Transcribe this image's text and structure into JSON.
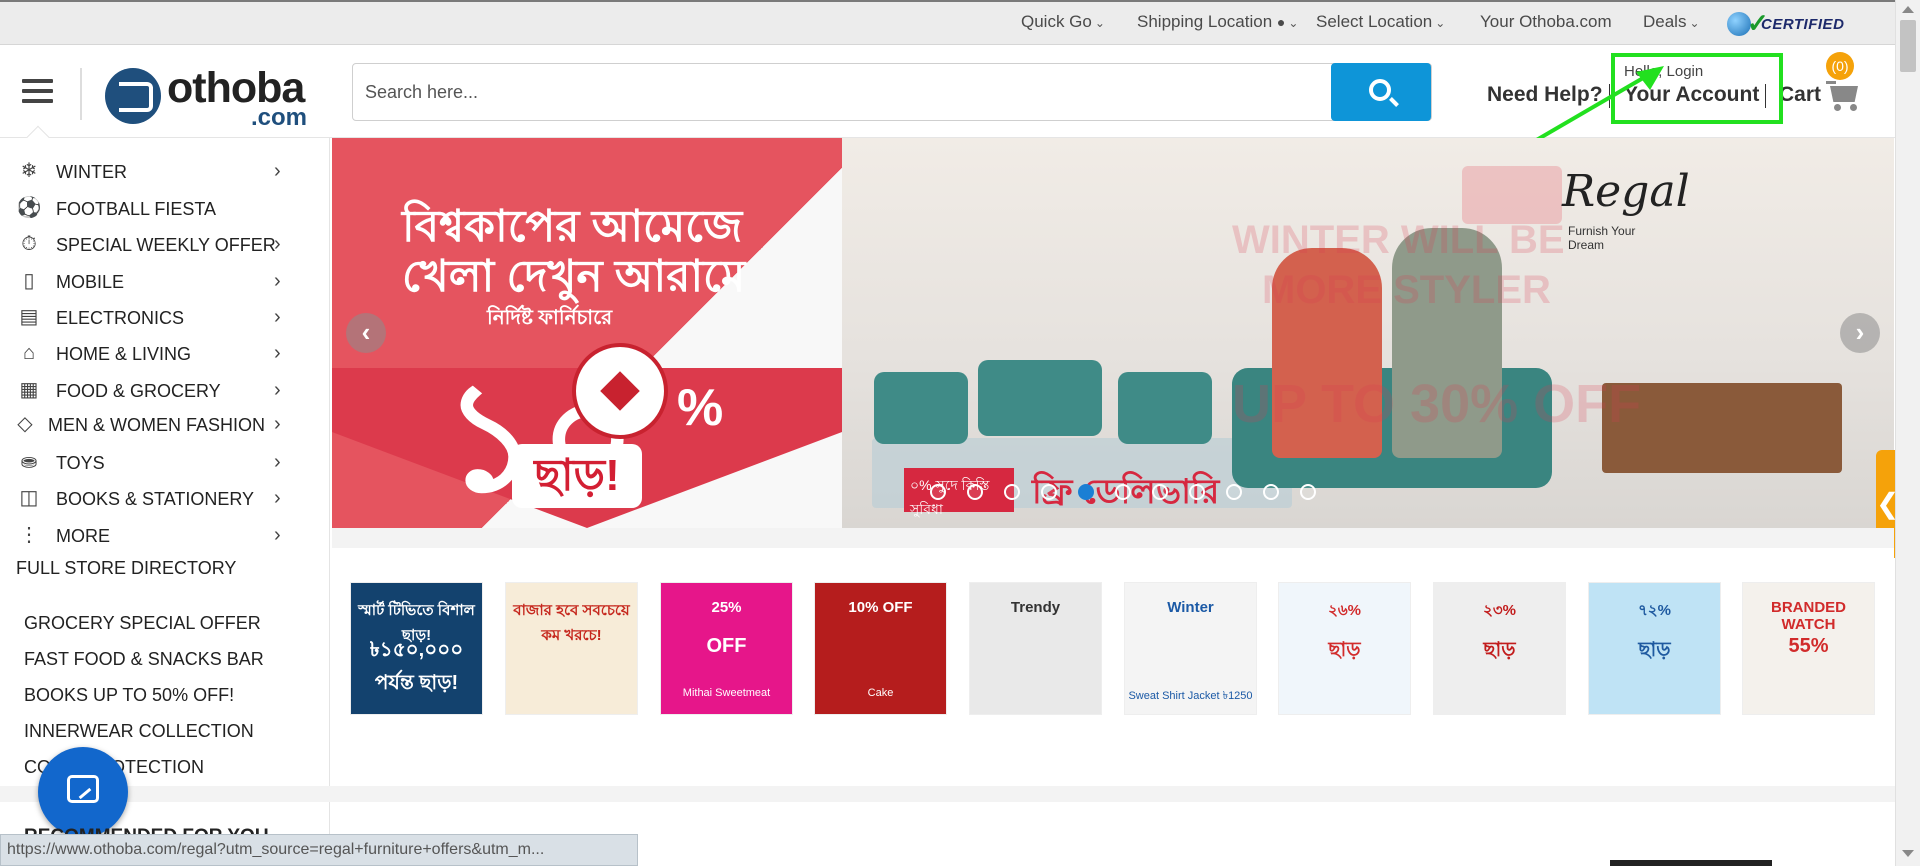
{
  "topbar": {
    "links": [
      "Quick Go",
      "Shipping Location",
      "Select Location",
      "Your Othoba.com",
      "Deals"
    ],
    "certified": "CERTIFIED"
  },
  "header": {
    "logo_name": "othoba",
    "logo_suffix": ".com",
    "search_placeholder": "Search here...",
    "need_help": "Need Help?",
    "hello": "Hello, Login",
    "your_account": "Your Account",
    "cart": "Cart",
    "cart_count": "(0)",
    "highlight_color": "#22e01f",
    "accent_color": "#0e95d8"
  },
  "sidebar": {
    "categories": [
      {
        "label": "WINTER",
        "icon": "snowflake-icon"
      },
      {
        "label": "FOOTBALL FIESTA",
        "icon": "soccer-ball-icon"
      },
      {
        "label": "SPECIAL WEEKLY OFFER",
        "icon": "stopwatch-icon"
      },
      {
        "label": "MOBILE",
        "icon": "mobile-phone-icon"
      },
      {
        "label": "ELECTRONICS",
        "icon": "electronics-icon"
      },
      {
        "label": "HOME & LIVING",
        "icon": "home-icon"
      },
      {
        "label": "FOOD & GROCERY",
        "icon": "basket-icon"
      },
      {
        "label": "MEN & WOMEN FASHION",
        "icon": "diamond-icon"
      },
      {
        "label": "TOYS",
        "icon": "toy-car-icon"
      },
      {
        "label": "BOOKS & STATIONERY",
        "icon": "book-icon"
      },
      {
        "label": "MORE",
        "icon": "more-dots-icon"
      }
    ],
    "store_directory": "FULL STORE DIRECTORY",
    "promos": [
      "GROCERY SPECIAL OFFER",
      "FAST FOOD & SNACKS BAR",
      "BOOKS UP TO 50% OFF!",
      "INNERWEAR COLLECTION",
      "COVID PROTECTION"
    ],
    "recommended": "RECOMMENDED FOR YOU"
  },
  "banner": {
    "bangla_line1": "বিশ্বকাপের আমেজে",
    "bangla_line2": "খেলা দেখুন আরামে",
    "bangla_sub": "নির্দিষ্ট ফার্নিচারে",
    "percent": "১০",
    "percent_sign": "%",
    "off": "ছাড়!",
    "free_delivery_badge": "০% সুদে কিস্তি সুবিধা",
    "free_delivery": "ফ্রি ডেলিভারি",
    "ghost_line1": "WINTER WILL BE",
    "ghost_line2": "MORE STYLER",
    "ghost_line3": "UP TO 30% OFF",
    "brand": "Regal",
    "brand_tag": "Furnish Your Dream",
    "prev": "‹",
    "next": "›",
    "dot_count": 11,
    "active_dot": 4
  },
  "tiles": [
    {
      "head": "স্মার্ট টিভিতে বিশাল ছাড়!",
      "big": "৳১৫০,০০০ পর্যন্ত ছাড়!",
      "sub": "",
      "bg": "#13426e",
      "fg": "#ffffff"
    },
    {
      "head": "বাজার হবে সবচেয়ে কম খরচে!",
      "big": "",
      "sub": "",
      "bg": "#f7ecd8",
      "fg": "#c6281e"
    },
    {
      "head": "25%",
      "big": "OFF",
      "sub": "Mithai Sweetmeat",
      "bg": "#e6168a",
      "fg": "#ffffff"
    },
    {
      "head": "10% OFF",
      "big": "",
      "sub": "Cake",
      "bg": "#b51d1d",
      "fg": "#ffffff"
    },
    {
      "head": "Trendy",
      "big": "",
      "sub": "",
      "bg": "#e9e9e9",
      "fg": "#333333"
    },
    {
      "head": "Winter",
      "big": "",
      "sub": "Sweat Shirt Jacket ৳1250",
      "bg": "#f4f4f4",
      "fg": "#1c5aa6"
    },
    {
      "head": "২৬%",
      "big": "ছাড়",
      "sub": "",
      "bg": "#f0f6fb",
      "fg": "#d22c2c"
    },
    {
      "head": "২৩%",
      "big": "ছাড়",
      "sub": "",
      "bg": "#eeeeee",
      "fg": "#c21c1c"
    },
    {
      "head": "৭২%",
      "big": "ছাড়",
      "sub": "",
      "bg": "#bfe3f5",
      "fg": "#1f5aa0"
    },
    {
      "head": "BRANDED WATCH",
      "big": "55%",
      "sub": "",
      "bg": "#f4f1ec",
      "fg": "#d12b2b"
    }
  ],
  "status_url": "https://www.othoba.com/regal?utm_source=regal+furniture+offers&utm_m..."
}
